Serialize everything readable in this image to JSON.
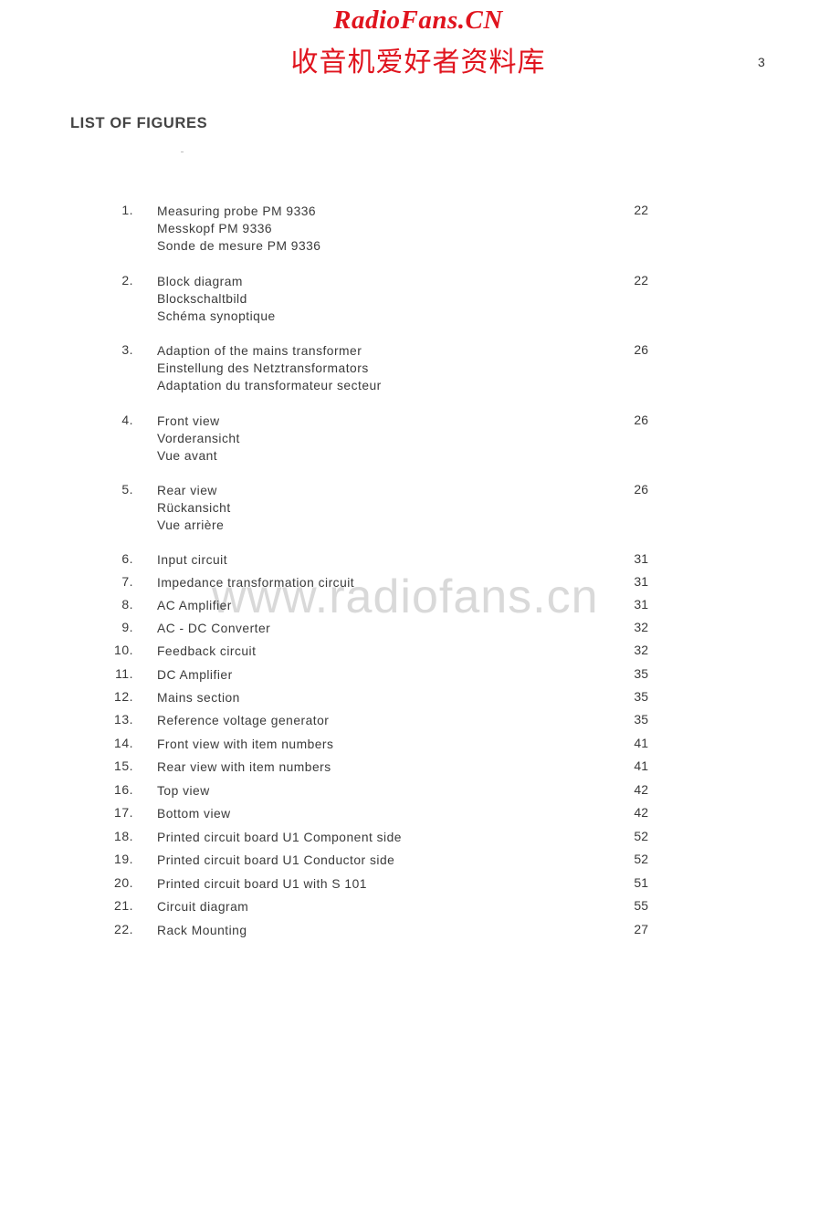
{
  "header": {
    "brand": "RadioFans.CN",
    "brand_cn": "收音机爱好者资料库",
    "page_number": "3"
  },
  "title": "LIST OF FIGURES",
  "watermark": "www.radiofans.cn",
  "figures": [
    {
      "number": "1.",
      "lines": [
        "Measuring probe PM 9336",
        "Messkopf PM 9336",
        "Sonde de mesure PM 9336"
      ],
      "page": "22"
    },
    {
      "number": "2.",
      "lines": [
        "Block diagram",
        "Blockschaltbild",
        "Schéma synoptique"
      ],
      "page": "22"
    },
    {
      "number": "3.",
      "lines": [
        "Adaption of the mains transformer",
        "Einstellung des Netztransformators",
        "Adaptation du transformateur secteur"
      ],
      "page": "26"
    },
    {
      "number": "4.",
      "lines": [
        "Front view",
        "Vorderansicht",
        "Vue avant"
      ],
      "page": "26"
    },
    {
      "number": "5.",
      "lines": [
        "Rear view",
        "Rückansicht",
        "Vue arrière"
      ],
      "page": "26"
    },
    {
      "number": "6.",
      "lines": [
        "Input circuit"
      ],
      "page": "31"
    },
    {
      "number": "7.",
      "lines": [
        "Impedance transformation circuit"
      ],
      "page": "31"
    },
    {
      "number": "8.",
      "lines": [
        "AC Amplifier"
      ],
      "page": "31"
    },
    {
      "number": "9.",
      "lines": [
        "AC - DC Converter"
      ],
      "page": "32"
    },
    {
      "number": "10.",
      "lines": [
        "Feedback circuit"
      ],
      "page": "32"
    },
    {
      "number": "11.",
      "lines": [
        "DC Amplifier"
      ],
      "page": "35"
    },
    {
      "number": "12.",
      "lines": [
        "Mains section"
      ],
      "page": "35"
    },
    {
      "number": "13.",
      "lines": [
        "Reference voltage generator"
      ],
      "page": "35"
    },
    {
      "number": "14.",
      "lines": [
        "Front view with item numbers"
      ],
      "page": "41"
    },
    {
      "number": "15.",
      "lines": [
        "Rear view with item numbers"
      ],
      "page": "41"
    },
    {
      "number": "16.",
      "lines": [
        "Top view"
      ],
      "page": "42"
    },
    {
      "number": "17.",
      "lines": [
        "Bottom view"
      ],
      "page": "42"
    },
    {
      "number": "18.",
      "lines": [
        "Printed circuit board U1 Component side"
      ],
      "page": "52"
    },
    {
      "number": "19.",
      "lines": [
        "Printed circuit board U1 Conductor side"
      ],
      "page": "52"
    },
    {
      "number": "20.",
      "lines": [
        "Printed circuit board U1 with S 101"
      ],
      "page": "51"
    },
    {
      "number": "21.",
      "lines": [
        "Circuit diagram"
      ],
      "page": "55"
    },
    {
      "number": "22.",
      "lines": [
        "Rack Mounting"
      ],
      "page": "27"
    }
  ]
}
